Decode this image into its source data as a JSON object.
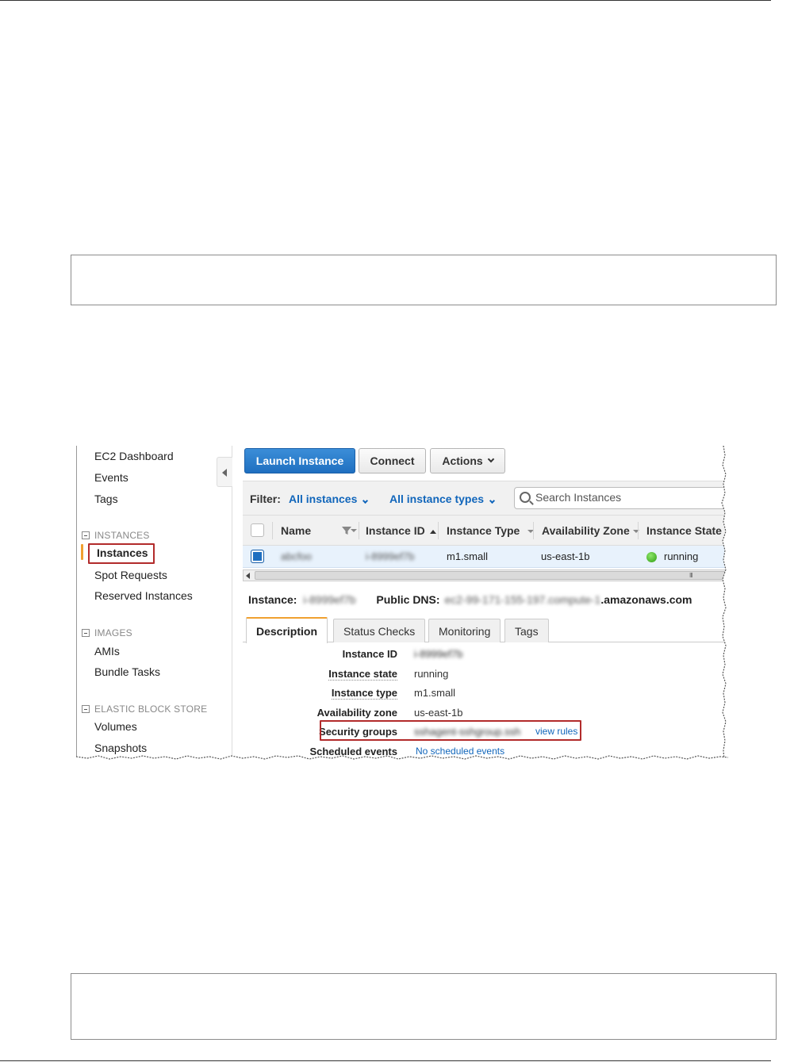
{
  "sidebar": {
    "links_top": [
      "EC2 Dashboard",
      "Events",
      "Tags"
    ],
    "sections": [
      {
        "heading": "INSTANCES",
        "items": [
          "Instances",
          "Spot Requests",
          "Reserved Instances"
        ]
      },
      {
        "heading": "IMAGES",
        "items": [
          "AMIs",
          "Bundle Tasks"
        ]
      },
      {
        "heading": "ELASTIC BLOCK STORE",
        "items": [
          "Volumes",
          "Snapshots"
        ]
      }
    ],
    "active_item": "Instances"
  },
  "toolbar": {
    "launch_label": "Launch Instance",
    "connect_label": "Connect",
    "actions_label": "Actions"
  },
  "filter": {
    "label": "Filter:",
    "state_dropdown": "All instances",
    "type_dropdown": "All instance types",
    "search_placeholder": "Search Instances"
  },
  "table": {
    "columns": [
      "Name",
      "Instance ID",
      "Instance Type",
      "Availability Zone",
      "Instance State"
    ],
    "sorted_column": "Instance ID",
    "rows": [
      {
        "name": "abcfoo",
        "instance_id": "i-8999ef7b",
        "instance_type": "m1.small",
        "availability_zone": "us-east-1b",
        "instance_state": "running",
        "selected": true
      }
    ],
    "scroll_grip": "III"
  },
  "details": {
    "instance_label": "Instance:",
    "instance_value": "i-8999ef7b",
    "dns_label": "Public DNS:",
    "dns_value_hidden": "ec2-99-171-155-197.compute-1",
    "dns_suffix": ".amazonaws.com",
    "tabs": [
      "Description",
      "Status Checks",
      "Monitoring",
      "Tags"
    ],
    "active_tab": "Description",
    "fields": {
      "instance_id": {
        "label": "Instance ID",
        "value": "i-8999ef7b"
      },
      "instance_state": {
        "label": "Instance state",
        "value": "running"
      },
      "instance_type": {
        "label": "Instance type",
        "value": "m1.small"
      },
      "availability_zone": {
        "label": "Availability zone",
        "value": "us-east-1b"
      },
      "security_groups": {
        "label": "Security groups",
        "value": "sshagent-sshgroup.ssh",
        "link": "view rules"
      },
      "scheduled_events": {
        "label": "Scheduled events",
        "value": "No scheduled events"
      }
    }
  },
  "colors": {
    "primary_button": "#1f6fc0",
    "link": "#1166bb",
    "highlight_box": "#b22b2b",
    "active_accent": "#f0a030",
    "running_status": "#2e9e12"
  }
}
